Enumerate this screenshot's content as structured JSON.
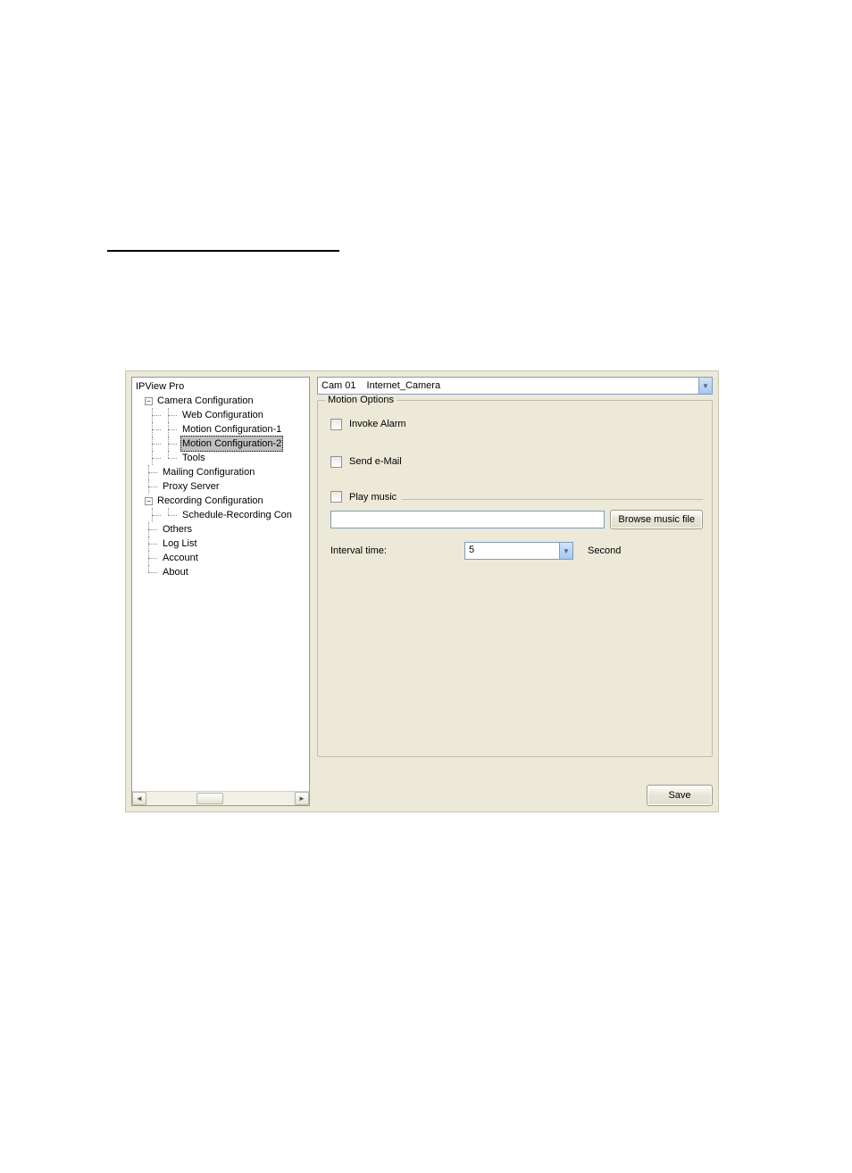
{
  "tree": {
    "root": "IPView Pro",
    "camera_config": "Camera Configuration",
    "web_config": "Web Configuration",
    "motion_config_1": "Motion Configuration-1",
    "motion_config_2": "Motion Configuration-2",
    "tools": "Tools",
    "mailing_config": "Mailing Configuration",
    "proxy_server": "Proxy Server",
    "recording_config": "Recording Configuration",
    "schedule_recording": "Schedule-Recording Con",
    "others": "Others",
    "log_list": "Log List",
    "account": "Account",
    "about": "About"
  },
  "camera_select": {
    "cam_id": "Cam 01",
    "cam_name": "Internet_Camera"
  },
  "motion": {
    "group_title": "Motion Options",
    "invoke_alarm": "Invoke Alarm",
    "send_email": "Send e-Mail",
    "play_music": "Play music",
    "browse_btn": "Browse music file",
    "interval_label": "Interval time:",
    "interval_value": "5",
    "interval_unit": "Second"
  },
  "buttons": {
    "save": "Save"
  },
  "icons": {
    "minus": "−",
    "left": "◄",
    "right": "►",
    "down": "▼"
  }
}
